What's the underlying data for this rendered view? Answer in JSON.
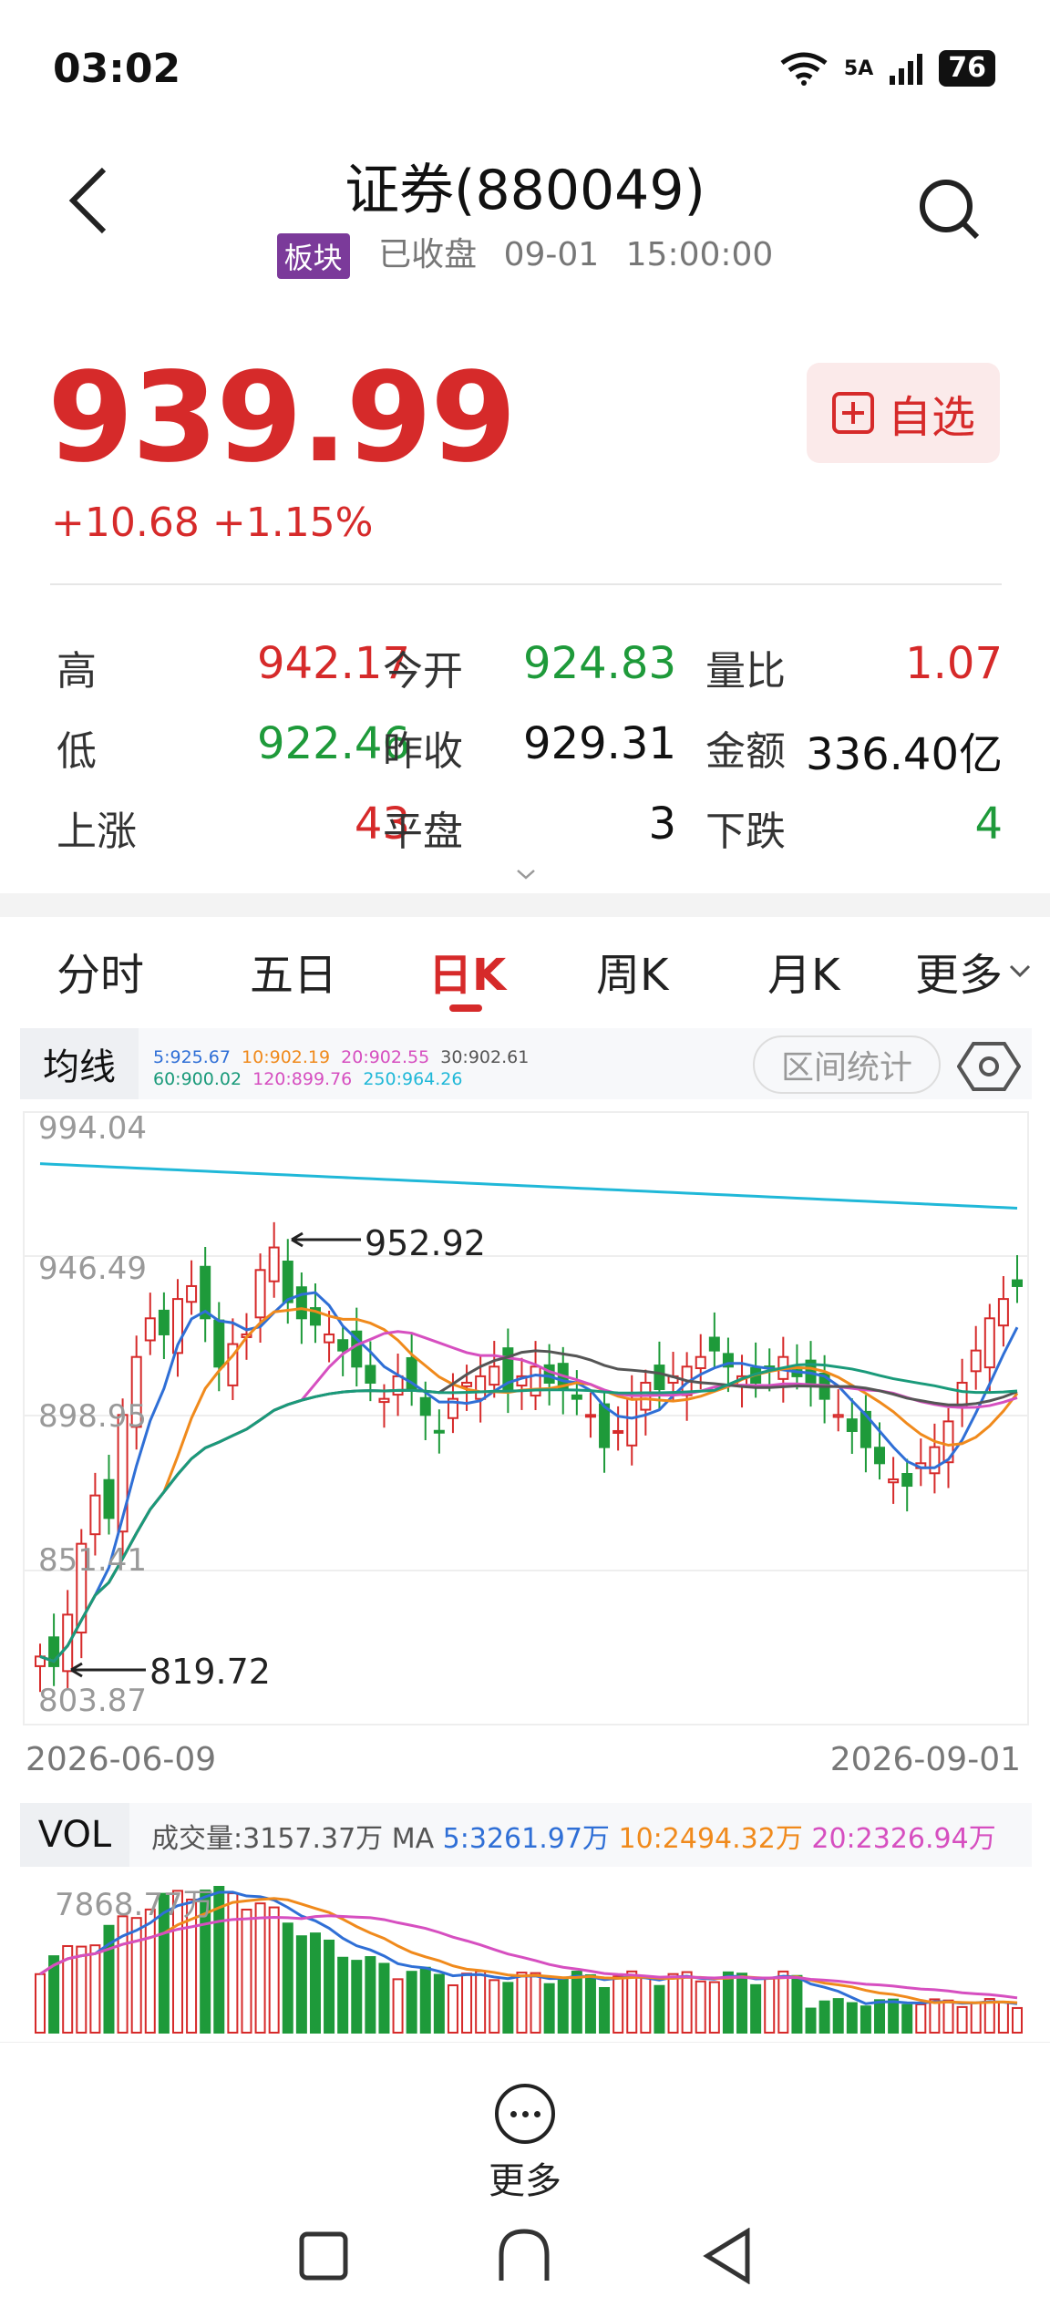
{
  "status": {
    "time": "03:02",
    "network": "5A",
    "battery": "76"
  },
  "header": {
    "title": "证券(880049)",
    "tag": "板块",
    "state": "已收盘",
    "date": "09-01",
    "clock": "15:00:00"
  },
  "quote": {
    "price": "939.99",
    "change": "+10.68",
    "change_pct": "+1.15%",
    "fav_label": "自选"
  },
  "stats": {
    "high_label": "高",
    "high": "942.17",
    "open_label": "今开",
    "open": "924.83",
    "ratio_label": "量比",
    "ratio": "1.07",
    "low_label": "低",
    "low": "922.46",
    "prev_label": "昨收",
    "prev": "929.31",
    "amount_label": "金额",
    "amount": "336.40亿",
    "up_label": "上涨",
    "up": "43",
    "flat_label": "平盘",
    "flat": "3",
    "down_label": "下跌",
    "down": "4"
  },
  "tabs": [
    "分时",
    "五日",
    "日K",
    "周K",
    "月K",
    "更多"
  ],
  "active_tab": "日K",
  "ma_legend": {
    "label": "均线",
    "ma5": "5:925.67",
    "ma10": "10:902.19",
    "ma20": "20:902.55",
    "ma30": "30:902.61",
    "ma60": "60:900.02",
    "ma120": "120:899.76",
    "ma250": "250:964.26",
    "range_stats": "区间统计"
  },
  "chart_data": {
    "type": "candlestick",
    "y_ticks": [
      "994.04",
      "946.49",
      "898.95",
      "851.41",
      "803.87"
    ],
    "ylim": [
      803.87,
      994.04
    ],
    "max_label": "952.92",
    "min_label": "819.72",
    "x_start": "2026-06-09",
    "x_end": "2026-09-01",
    "ma_colors": {
      "ma5": "#2f6fd6",
      "ma10": "#f08a1c",
      "ma20": "#d64fc0",
      "ma30": "#555555",
      "ma60": "#1a9a7a",
      "ma250": "#20b8d8"
    }
  },
  "volume": {
    "label": "VOL",
    "today": "成交量:3157.37万",
    "ma_prefix": "MA",
    "ma5": "5:3261.97万",
    "ma10": "10:2494.32万",
    "ma20": "20:2326.94万",
    "max_label": "7868.77万"
  },
  "bottom": {
    "more_label": "更多"
  },
  "colors": {
    "up": "#d62a2a",
    "down": "#1e9a3a",
    "tag": "#7b3a9a"
  }
}
